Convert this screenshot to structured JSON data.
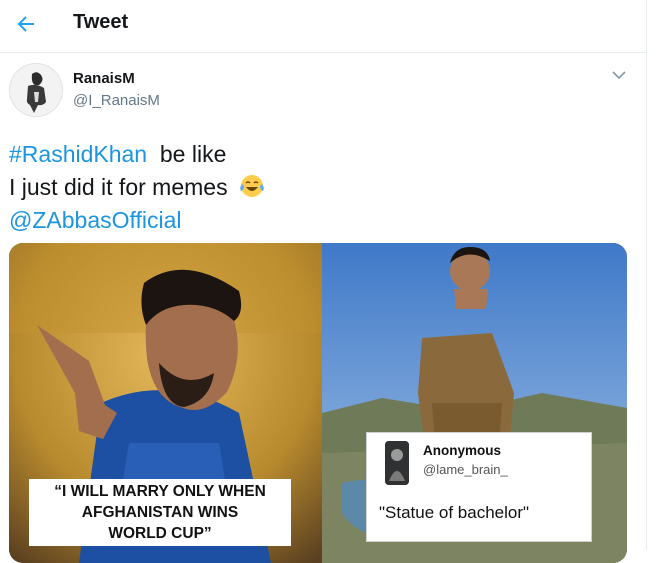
{
  "header": {
    "title": "Tweet"
  },
  "user": {
    "name": "RanaisM",
    "handle": "@I_RanaisM"
  },
  "tweet": {
    "hashtag": "#RashidKhan",
    "after_hashtag": "be like",
    "line2": "I just did it for memes",
    "emoji": "face-with-tears-of-joy",
    "mention": "@ZAbbasOfficial"
  },
  "media": {
    "left_caption": [
      "“I WILL MARRY ONLY WHEN",
      "AFGHANISTAN WINS",
      "WORLD CUP”"
    ],
    "card": {
      "name": "Anonymous",
      "handle": "@lame_brain_",
      "quote": "\"Statue of bachelor\""
    }
  },
  "colors": {
    "link": "#1b95e0",
    "secondary": "#657786",
    "divider": "#e6ecf0"
  },
  "icons": [
    "back-arrow-icon",
    "chevron-down-icon",
    "laughing-emoji-icon"
  ]
}
